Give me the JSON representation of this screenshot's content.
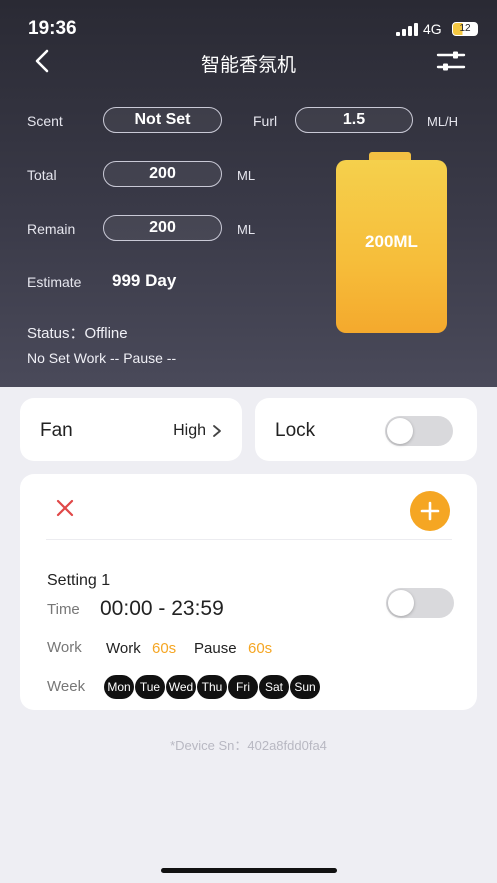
{
  "status_bar": {
    "time": "19:36",
    "network": "4G",
    "battery": "12"
  },
  "header": {
    "title": "智能香氛机"
  },
  "info": {
    "scent_label": "Scent",
    "scent_value": "Not Set",
    "furl_label": "Furl",
    "furl_value": "1.5",
    "furl_unit": "ML/H",
    "total_label": "Total",
    "total_value": "200",
    "total_unit": "ML",
    "remain_label": "Remain",
    "remain_value": "200",
    "remain_unit": "ML",
    "estimate_label": "Estimate",
    "estimate_value": "999 Day",
    "status_text": "Status：Offline",
    "work_text": "No Set Work -- Pause --",
    "bottle_label": "200ML",
    "bottle_fill": 1.0
  },
  "fan": {
    "label": "Fan",
    "value": "High"
  },
  "lock": {
    "label": "Lock",
    "enabled": false
  },
  "schedule": {
    "title": "Setting 1",
    "time_label": "Time",
    "time_value": "00:00 - 23:59",
    "work_label": "Work",
    "work_text": "Work",
    "work_value": "60s",
    "pause_text": "Pause",
    "pause_value": "60s",
    "week_label": "Week",
    "days": [
      "Mon",
      "Tue",
      "Wed",
      "Thu",
      "Fri",
      "Sat",
      "Sun"
    ],
    "enabled": false
  },
  "device_sn": "*Device Sn：402a8fdd0fa4",
  "colors": {
    "accent": "#f5a623",
    "bottle": "#f6bd3a",
    "delete": "#e04848",
    "header_bg": "#2a2a34"
  },
  "icons": [
    "back-chevron-icon",
    "settings-sliders-icon",
    "chevron-right-icon",
    "close-icon",
    "plus-icon"
  ]
}
